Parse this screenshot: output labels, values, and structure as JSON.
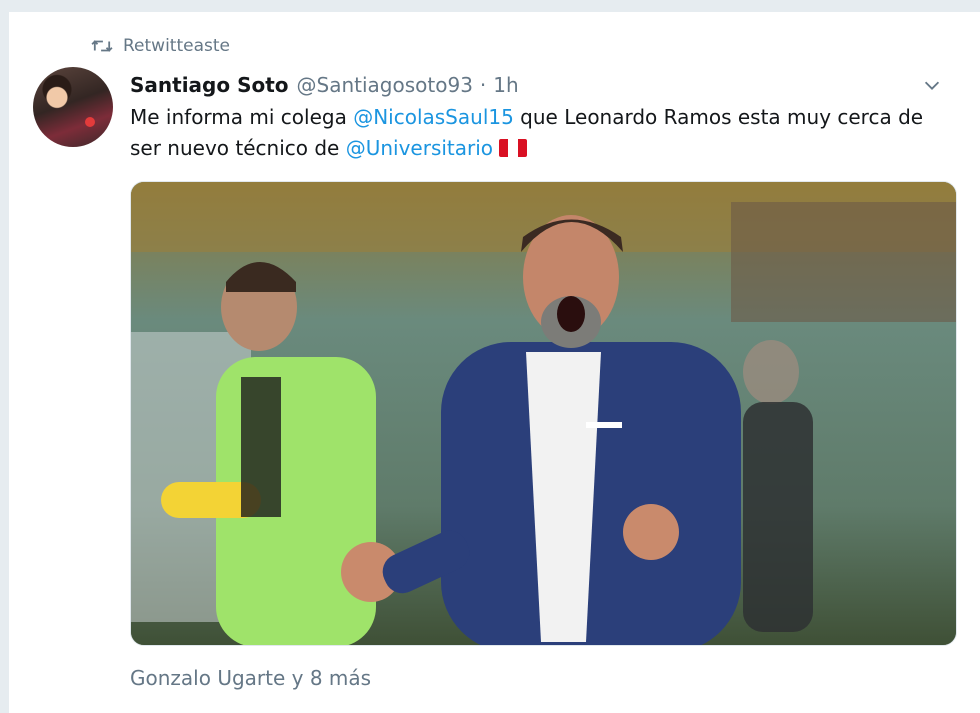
{
  "retweet": {
    "label": "Retwitteaste"
  },
  "tweet": {
    "author_name": "Santiago Soto",
    "author_handle": "@Santiagosoto93",
    "separator": "·",
    "time": "1h",
    "text_part1": "Me informa mi colega ",
    "mention1": "@NicolasSaul15",
    "text_part2": " que Leonardo Ramos esta muy cerca de ser nuevo técnico de ",
    "mention2": "@Universitario",
    "flag": "peru-flag-icon"
  },
  "footer": {
    "likes_text": "Gonzalo Ugarte y 8 más"
  },
  "colors": {
    "link": "#1b95e0",
    "muted": "#657786",
    "text": "#14171a",
    "background": "#e6ecf0"
  }
}
